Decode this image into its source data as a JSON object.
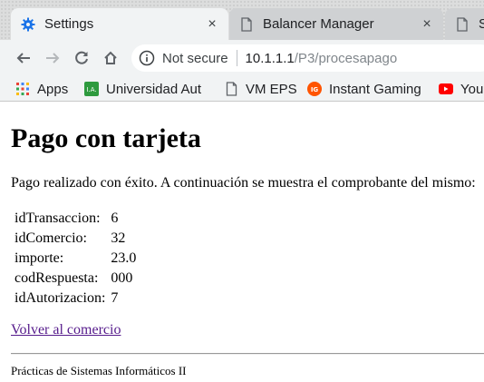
{
  "tabs": [
    {
      "label": "Settings",
      "icon": "gear-icon",
      "active": true
    },
    {
      "label": "Balancer Manager",
      "icon": "document-icon",
      "active": false
    },
    {
      "label": "S",
      "icon": "document-icon",
      "active": false
    }
  ],
  "tab_close_glyph": "×",
  "omnibox": {
    "security_label": "Not secure",
    "host": "10.1.1.1",
    "path": "/P3/procesapago"
  },
  "bookmarks": [
    {
      "label": "Apps",
      "icon": "apps-grid-icon"
    },
    {
      "label": "Universidad Aut",
      "icon": "university-favicon-icon"
    },
    {
      "label": "VM EPS",
      "icon": "document-icon"
    },
    {
      "label": "Instant Gaming",
      "icon": "instant-gaming-icon"
    },
    {
      "label": "You",
      "icon": "youtube-icon"
    }
  ],
  "page": {
    "title": "Pago con tarjeta",
    "message": "Pago realizado con éxito. A continuación se muestra el comprobante del mismo:",
    "receipt": [
      {
        "label": "idTransaccion:",
        "value": "6"
      },
      {
        "label": "idComercio:",
        "value": "32"
      },
      {
        "label": "importe:",
        "value": "23.0"
      },
      {
        "label": "codRespuesta:",
        "value": "000"
      },
      {
        "label": "idAutorizacion:",
        "value": "7"
      }
    ],
    "back_link": "Volver al comercio",
    "footer": "Prácticas de Sistemas Informáticos II"
  },
  "colors": {
    "accent_blue": "#1a73e8",
    "visited_link": "#551a8b",
    "instant_gaming": "#ff5400",
    "youtube_red": "#ff0000"
  }
}
